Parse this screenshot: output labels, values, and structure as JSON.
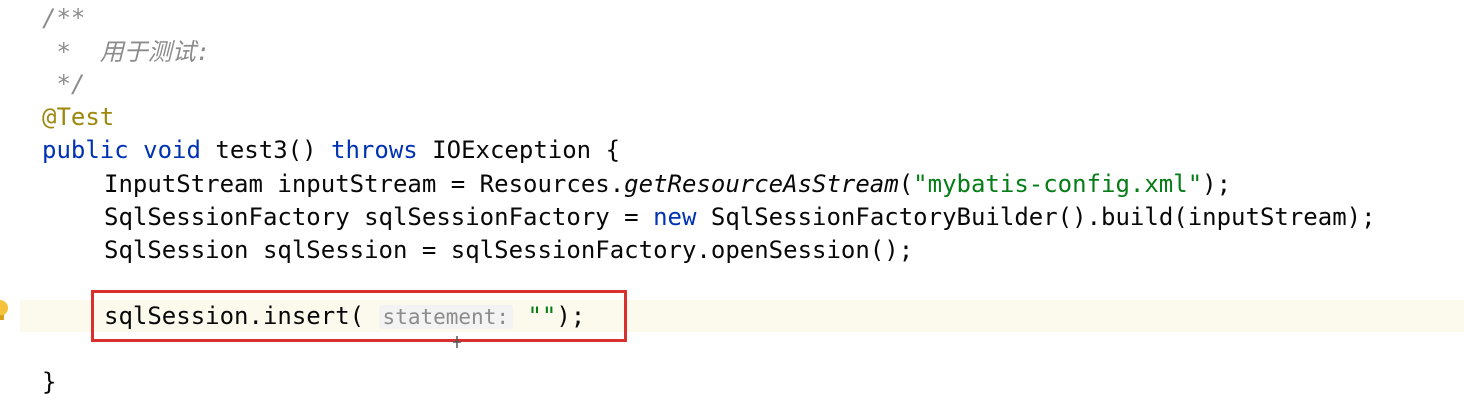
{
  "comment": {
    "open": "/**",
    "body": " *  用于测试:",
    "close": " */"
  },
  "annotation": "@Test",
  "method": {
    "kw_public": "public",
    "kw_void": "void",
    "signature": "test3()",
    "kw_throws": "throws",
    "exception": "IOException {"
  },
  "line_input": {
    "prefix": "InputStream inputStream = Resources.",
    "call": "getResourceAsStream",
    "open_paren": "(",
    "arg": "\"mybatis-config.xml\"",
    "suffix": ");"
  },
  "line_factory": {
    "prefix": "SqlSessionFactory sqlSessionFactory = ",
    "kw_new": "new",
    "suffix": " SqlSessionFactoryBuilder().build(inputStream);"
  },
  "line_session": "SqlSession sqlSession = sqlSessionFactory.openSession();",
  "line_insert": {
    "prefix": "sqlSession.insert(",
    "hint": "statement:",
    "arg": "\"\"",
    "suffix": ");"
  },
  "closing_brace": "}",
  "colors": {
    "keyword": "#0033b3",
    "string": "#067d17",
    "annotation": "#9e880d",
    "comment": "#8c8c8c",
    "highlight_border": "#d9302f"
  },
  "icons": {
    "gutter": "lightbulb-icon",
    "mouse": "text-cursor-icon"
  }
}
